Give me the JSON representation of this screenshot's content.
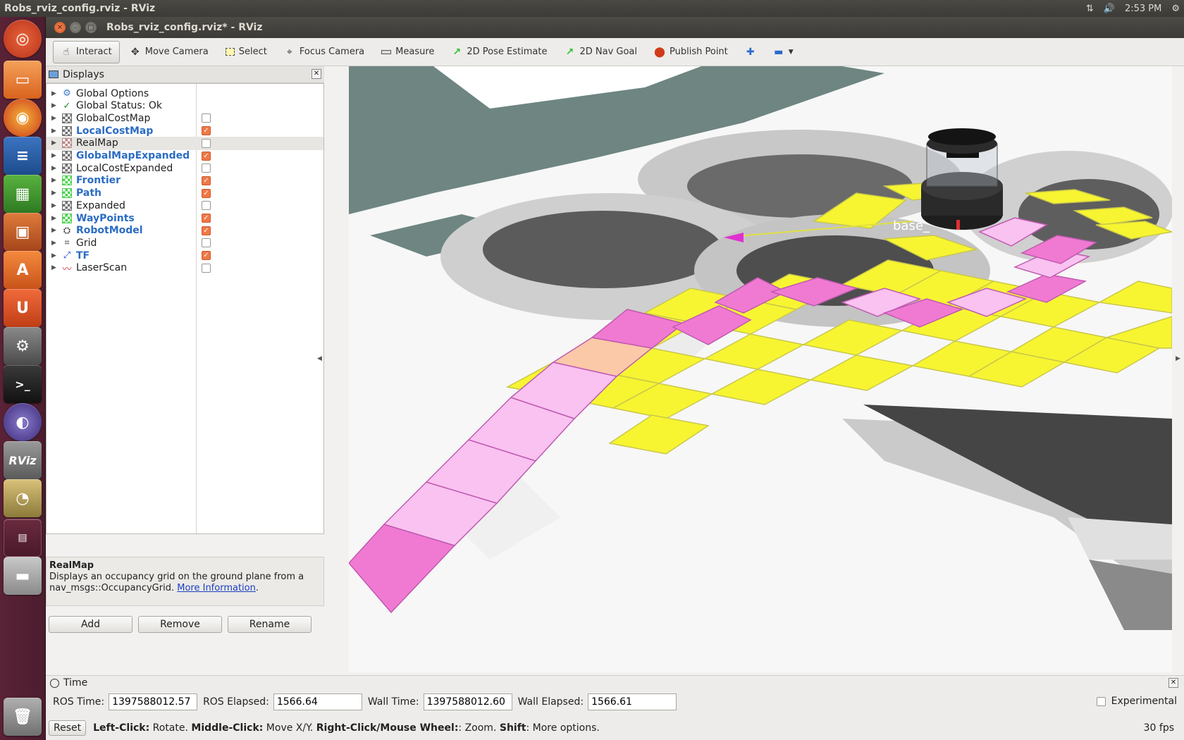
{
  "top_panel": {
    "title": "Robs_rviz_config.rviz - RViz",
    "clock": "2:53 PM"
  },
  "launcher": {
    "items": [
      "ubuntu-dash",
      "files",
      "firefox",
      "writer",
      "calc",
      "impress",
      "software-center",
      "ubuntu-one",
      "system-settings",
      "terminal",
      "eclipse",
      "rviz",
      "image-viewer",
      "workspaces",
      "disk",
      "trash"
    ]
  },
  "window": {
    "title": "Robs_rviz_config.rviz* - RViz"
  },
  "toolbar": {
    "tools": [
      {
        "label": "Interact",
        "icon": "hand-icon",
        "active": true
      },
      {
        "label": "Move Camera",
        "icon": "move-camera-icon"
      },
      {
        "label": "Select",
        "icon": "select-icon"
      },
      {
        "label": "Focus Camera",
        "icon": "focus-camera-icon"
      },
      {
        "label": "Measure",
        "icon": "ruler-icon"
      },
      {
        "label": "2D Pose Estimate",
        "icon": "pose-arrow-icon"
      },
      {
        "label": "2D Nav Goal",
        "icon": "goal-arrow-icon"
      },
      {
        "label": "Publish Point",
        "icon": "map-pin-icon"
      }
    ]
  },
  "displays": {
    "header": "Displays",
    "items": [
      {
        "label": "Global Options",
        "icon": "gear-icon",
        "checkbox": null,
        "enabled": false
      },
      {
        "label": "Global Status: Ok",
        "icon": "check-icon",
        "checkbox": null,
        "enabled": false
      },
      {
        "label": "GlobalCostMap",
        "icon": "grid-icon",
        "checkbox": false,
        "enabled": false
      },
      {
        "label": "LocalCostMap",
        "icon": "grid-icon",
        "checkbox": true,
        "enabled": true
      },
      {
        "label": "RealMap",
        "icon": "grid-icon",
        "checkbox": false,
        "enabled": false,
        "selected": true
      },
      {
        "label": "GlobalMapExpanded",
        "icon": "grid-icon",
        "checkbox": true,
        "enabled": true
      },
      {
        "label": "LocalCostExpanded",
        "icon": "grid-icon",
        "checkbox": false,
        "enabled": false
      },
      {
        "label": "Frontier",
        "icon": "grid-icon",
        "checkbox": true,
        "enabled": true
      },
      {
        "label": "Path",
        "icon": "grid-icon",
        "checkbox": true,
        "enabled": true
      },
      {
        "label": "Expanded",
        "icon": "grid-icon",
        "checkbox": false,
        "enabled": false
      },
      {
        "label": "WayPoints",
        "icon": "grid-icon",
        "checkbox": true,
        "enabled": true
      },
      {
        "label": "RobotModel",
        "icon": "robot-icon",
        "checkbox": true,
        "enabled": true
      },
      {
        "label": "Grid",
        "icon": "grid-lines-icon",
        "checkbox": false,
        "enabled": false
      },
      {
        "label": "TF",
        "icon": "axes-icon",
        "checkbox": true,
        "enabled": true
      },
      {
        "label": "LaserScan",
        "icon": "laser-icon",
        "checkbox": false,
        "enabled": false
      }
    ],
    "description": {
      "title": "RealMap",
      "text": "Displays an occupancy grid on the ground plane from a nav_msgs::OccupancyGrid.",
      "link": "More Information"
    },
    "buttons": {
      "add": "Add",
      "remove": "Remove",
      "rename": "Rename"
    }
  },
  "view": {
    "frame_label": "base_"
  },
  "time": {
    "header": "Time",
    "ros_time_label": "ROS Time:",
    "ros_time": "1397588012.57",
    "ros_elapsed_label": "ROS Elapsed:",
    "ros_elapsed": "1566.64",
    "wall_time_label": "Wall Time:",
    "wall_time": "1397588012.60",
    "wall_elapsed_label": "Wall Elapsed:",
    "wall_elapsed": "1566.61",
    "experimental_label": "Experimental"
  },
  "status": {
    "reset": "Reset",
    "left_click": "Left-Click:",
    "left_click_text": " Rotate. ",
    "middle_click": "Middle-Click:",
    "middle_click_text": " Move X/Y. ",
    "right_click": "Right-Click/Mouse Wheel:",
    "right_click_text": ": Zoom. ",
    "shift": "Shift",
    "shift_text": ": More options.",
    "fps": "30 fps"
  },
  "colors": {
    "frontier_yellow": "#f7f532",
    "path_pink": "#f07ad2",
    "path_light_pink": "#f9c2f0",
    "checkbox_checked": "#f07846",
    "enabled_label": "#2b6cc4"
  }
}
